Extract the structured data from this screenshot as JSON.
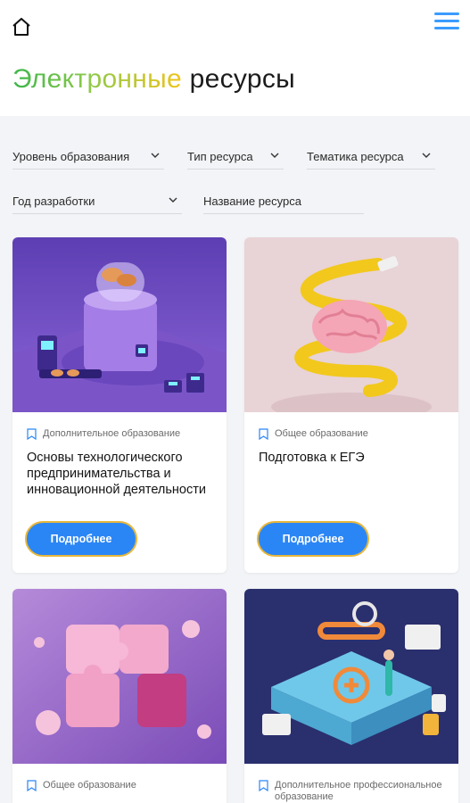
{
  "header": {
    "home_icon": "home-icon",
    "menu_icon": "hamburger-menu-icon",
    "menu_color": "#3b9bff"
  },
  "page": {
    "title_accent": "Электронные",
    "title_rest": "ресурсы"
  },
  "filters": {
    "level": "Уровень образования",
    "type": "Тип ресурса",
    "topic": "Тематика ресурса",
    "year": "Год разработки",
    "name_placeholder": "Название ресурса"
  },
  "cards": [
    {
      "category": "Дополнительное образование",
      "title": "Основы технологического предпринимательства и инновационной деятельности",
      "button": "Подробнее"
    },
    {
      "category": "Общее образование",
      "title": "Подготовка к ЕГЭ",
      "button": "Подробнее"
    },
    {
      "category": "Общее образование",
      "title": "",
      "button": ""
    },
    {
      "category": "Дополнительное профессиональное образование",
      "title": "",
      "button": ""
    }
  ],
  "colors": {
    "accent_button": "#2b86f5",
    "button_border": "#e8b73a",
    "title_gradient": [
      "#3db64a",
      "#f0c419"
    ]
  }
}
